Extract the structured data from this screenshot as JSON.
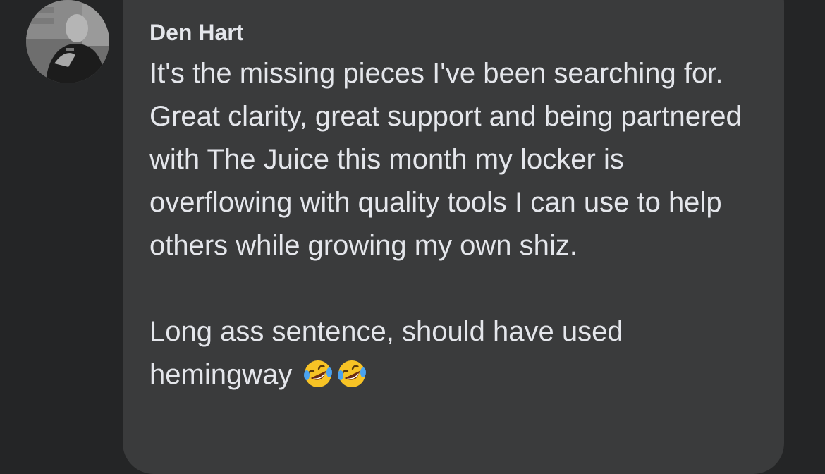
{
  "comment": {
    "author": "Den Hart",
    "paragraph1": "It's the missing pieces I've been searching for. Great clarity, great support and being partnered with The Juice this month my locker is overflowing with quality tools I can use to help others while growing my own shiz.",
    "paragraph2": "Long ass sentence, should have used hemingway",
    "emojis": [
      "rolling-on-floor-laughing",
      "rolling-on-floor-laughing"
    ]
  },
  "colors": {
    "background": "#242526",
    "bubble": "#3a3b3c",
    "text": "#e4e6eb",
    "emoji_face": "#f7c325"
  }
}
